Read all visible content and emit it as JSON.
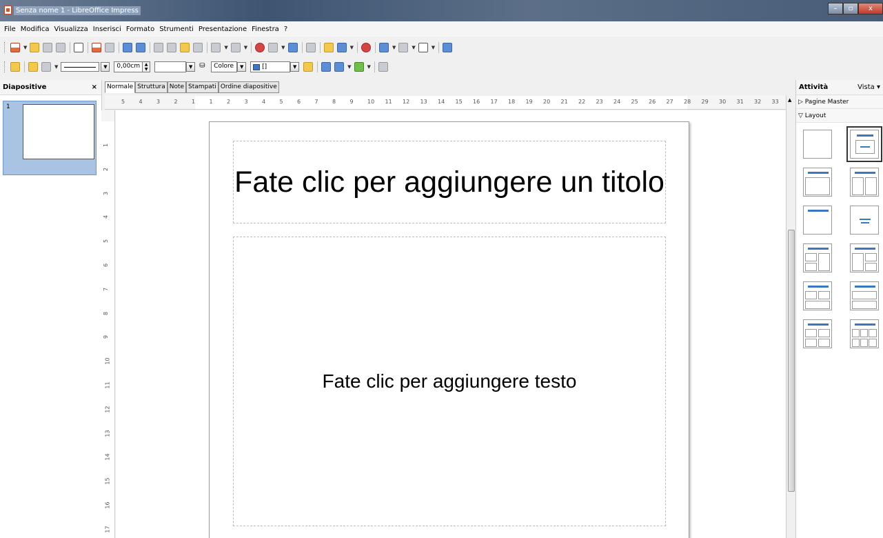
{
  "window": {
    "title": "Senza nome 1 - LibreOffice Impress"
  },
  "menu": [
    "File",
    "Modifica",
    "Visualizza",
    "Inserisci",
    "Formato",
    "Strumenti",
    "Presentazione",
    "Finestra",
    "?"
  ],
  "toolbar2": {
    "line_width": "0,00cm",
    "area_style": "Colore",
    "area_color": "[]"
  },
  "slides_panel": {
    "title": "Diapositive",
    "close": "×",
    "slide_number": "1"
  },
  "view_tabs": [
    "Normale",
    "Struttura",
    "Note",
    "Stampati",
    "Ordine diapositive"
  ],
  "hruler_labels": [
    "5",
    "4",
    "3",
    "2",
    "1",
    "1",
    "2",
    "3",
    "4",
    "5",
    "6",
    "7",
    "8",
    "9",
    "10",
    "11",
    "12",
    "13",
    "14",
    "15",
    "16",
    "17",
    "18",
    "19",
    "20",
    "21",
    "22",
    "23",
    "24",
    "25",
    "26",
    "27",
    "28",
    "29",
    "30",
    "31",
    "32",
    "33"
  ],
  "vruler_labels": [
    "1",
    "2",
    "3",
    "4",
    "5",
    "6",
    "7",
    "8",
    "9",
    "10",
    "11",
    "12",
    "13",
    "14",
    "15",
    "16",
    "17"
  ],
  "slide": {
    "title_placeholder": "Fate clic per aggiungere un titolo",
    "body_placeholder": "Fate clic per aggiungere testo"
  },
  "task_panel": {
    "title": "Attività",
    "view": "Vista ▾",
    "master_pages": "▷ Pagine Master",
    "layout": "▽ Layout"
  },
  "colors": {
    "accent": "#3a76c1",
    "slide_selection": "#a9c4e2"
  }
}
